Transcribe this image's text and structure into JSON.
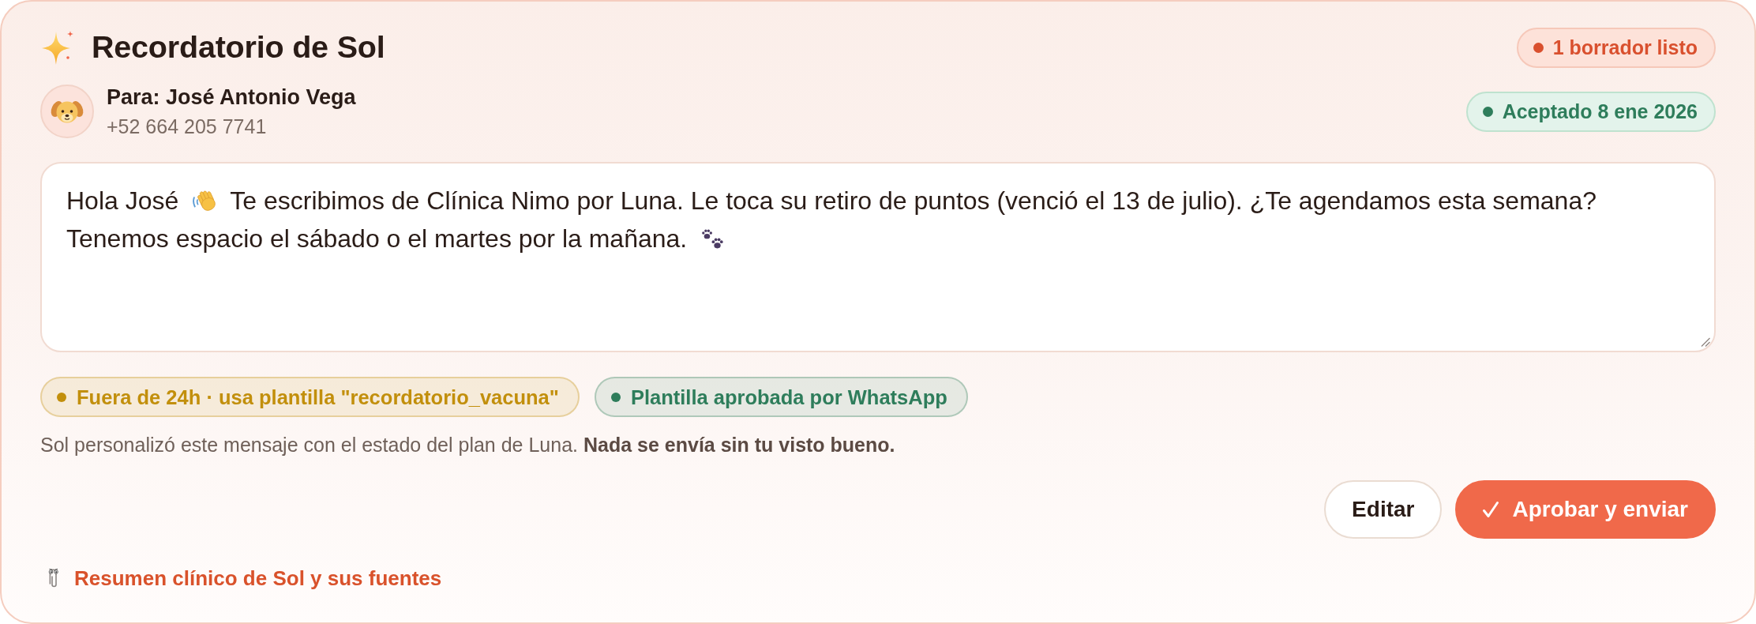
{
  "header": {
    "title": "Recordatorio de Sol",
    "draft_badge": "1 borrador listo"
  },
  "recipient": {
    "name_line": "Para: José Antonio Vega",
    "phone": "+52 664 205 7741",
    "consent_badge": "Aceptado 8 ene 2026"
  },
  "message": {
    "greeting": "Hola José",
    "text": "Te escribimos de Clínica Nimo por Luna. Le toca su retiro de puntos (venció el 13 de julio). ¿Te agendamos esta semana?",
    "closing": "Tenemos espacio el sábado o el martes por la mañana."
  },
  "chips": [
    {
      "label": "Fuera de 24h · usa plantilla \"recordatorio_vacuna\"",
      "color": "#c28f0c"
    },
    {
      "label": "Plantilla aprobada por WhatsApp",
      "color": "#2e7d5b"
    }
  ],
  "note": "Sol personalizó este mensaje con el estado del plan de Luna. **Nada se envía sin tu visto bueno.**",
  "actions": [
    {
      "label": "Editar",
      "kind": "secondary"
    },
    {
      "label": "Aprobar y enviar",
      "kind": "primary"
    }
  ],
  "sources_link": {
    "label": "Resumen clínico de Sol y sus fuentes"
  }
}
